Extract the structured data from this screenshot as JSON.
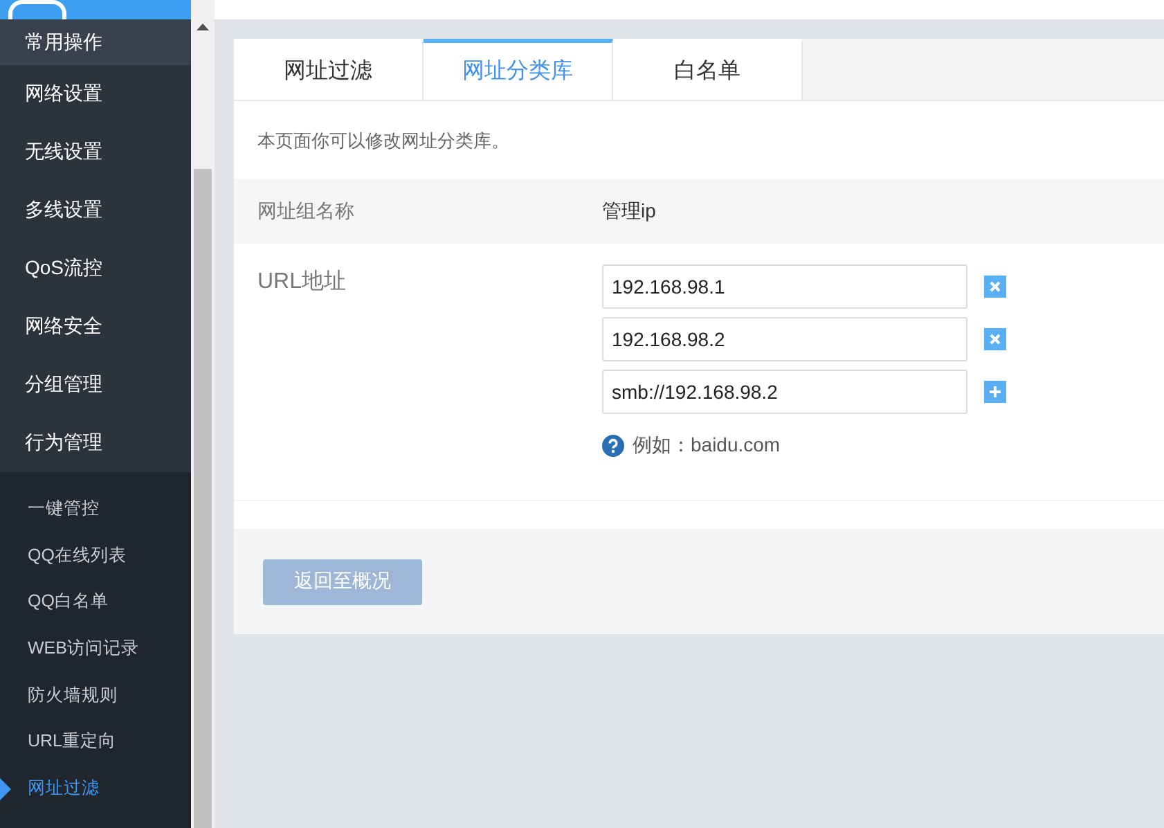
{
  "sidebar": {
    "menu": [
      {
        "label": "常用操作",
        "selected": true
      },
      {
        "label": "网络设置",
        "selected": false
      },
      {
        "label": "无线设置",
        "selected": false
      },
      {
        "label": "多线设置",
        "selected": false
      },
      {
        "label": "QoS流控",
        "selected": false
      },
      {
        "label": "网络安全",
        "selected": false
      },
      {
        "label": "分组管理",
        "selected": false
      },
      {
        "label": "行为管理",
        "selected": false
      }
    ],
    "submenu": [
      {
        "label": "一键管控",
        "selected": false
      },
      {
        "label": "QQ在线列表",
        "selected": false
      },
      {
        "label": "QQ白名单",
        "selected": false
      },
      {
        "label": "WEB访问记录",
        "selected": false
      },
      {
        "label": "防火墙规则",
        "selected": false
      },
      {
        "label": "URL重定向",
        "selected": false
      },
      {
        "label": "网址过滤",
        "selected": true
      }
    ]
  },
  "tabs": [
    {
      "label": "网址过滤",
      "selected": false
    },
    {
      "label": "网址分类库",
      "selected": true
    },
    {
      "label": "白名单",
      "selected": false
    }
  ],
  "description": "本页面你可以修改网址分类库。",
  "form": {
    "group_name_label": "网址组名称",
    "group_name_value": "管理ip",
    "url_label": "URL地址",
    "urls": [
      {
        "value": "192.168.98.1",
        "kind": "remove"
      },
      {
        "value": "192.168.98.2",
        "kind": "remove"
      },
      {
        "value": "smb://192.168.98.2",
        "kind": "add"
      }
    ],
    "hint": "例如：baidu.com"
  },
  "back_button": {
    "label": "返回至概况",
    "disabled": true
  }
}
